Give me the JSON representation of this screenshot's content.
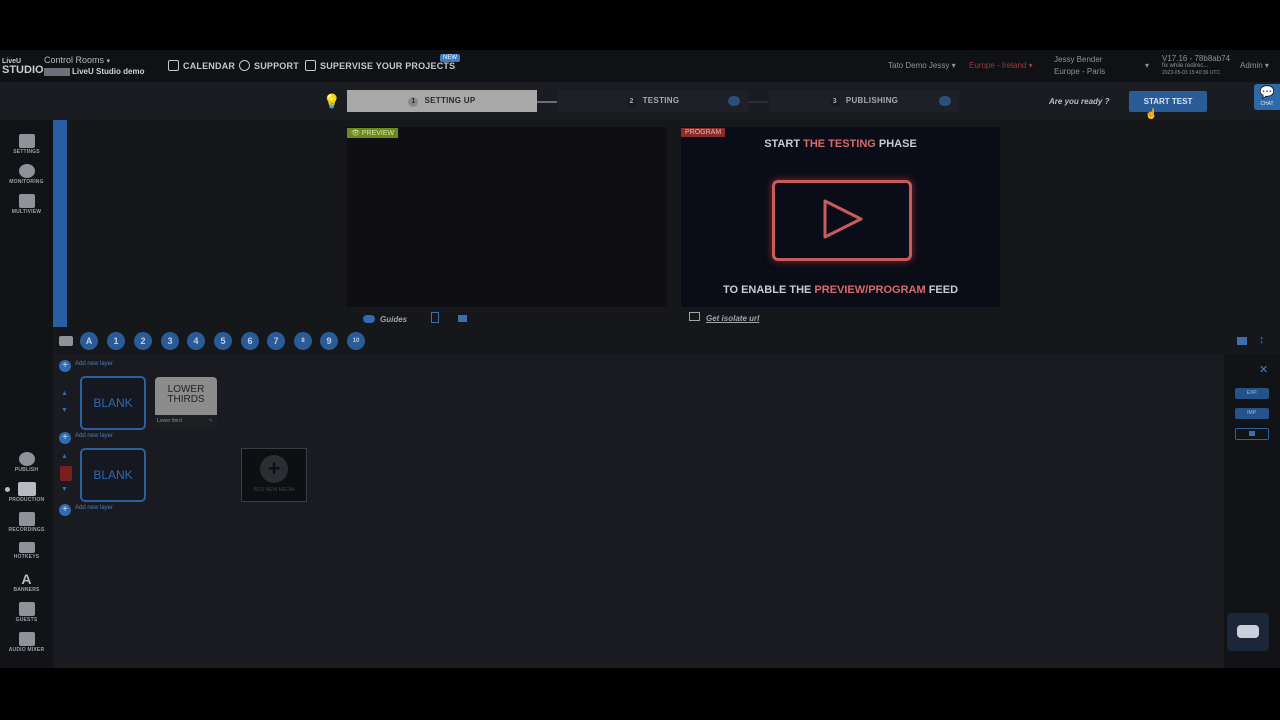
{
  "topbar": {
    "logo_line1": "LiveU",
    "logo_line2": "STUDIO",
    "control_rooms_label": "Control Rooms",
    "studio_name": "LiveU Studio demo",
    "nav": {
      "calendar": "CALENDAR",
      "support": "SUPPORT",
      "supervise": "SUPERVISE YOUR PROJECTS",
      "new_badge": "NEW"
    },
    "account": "Tato Demo Jessy",
    "region": "Europe - Ireland",
    "user_name": "Jessy Bender",
    "user_region": "Europe - Paris",
    "version": "V17.16 - 78b8ab74",
    "version_note": "fix while redirec...",
    "version_date": "2023-05-03 15:40:36 UTC",
    "admin": "Admin"
  },
  "wizard": {
    "steps": [
      {
        "num": "1",
        "label": "SETTING UP"
      },
      {
        "num": "2",
        "label": "TESTING"
      },
      {
        "num": "3",
        "label": "PUBLISHING"
      }
    ],
    "ready_text": "Are you ready ?",
    "start_button": "START TEST",
    "chat_label": "CHAT"
  },
  "sidebar": {
    "items": [
      {
        "label": "SETTINGS"
      },
      {
        "label": "MONITORING"
      },
      {
        "label": "MULTIVIEW"
      },
      {
        "label": "PUBLISH"
      },
      {
        "label": "PRODUCTION"
      },
      {
        "label": "RECORDINGS"
      },
      {
        "label": "HOTKEYS"
      },
      {
        "label": "BANNERS"
      },
      {
        "label": "GUESTS"
      },
      {
        "label": "AUDIO MIXER"
      }
    ]
  },
  "monitors": {
    "preview_label": "PREVIEW",
    "program_label": "PROGRAM",
    "program_title_a": "START ",
    "program_title_b": "THE TESTING",
    "program_title_c": " PHASE",
    "program_foot_a": "TO ENABLE THE ",
    "program_foot_b": "PREVIEW/PROGRAM",
    "program_foot_c": " FEED",
    "guides_label": "Guides",
    "get_url_label": "Get isolate url"
  },
  "layers": {
    "keys": [
      "A",
      "1",
      "2",
      "3",
      "4",
      "5",
      "6",
      "7",
      "8",
      "9",
      "10"
    ],
    "add_layer": "Add new layer",
    "blank_label": "BLANK",
    "lower_thirds_line1": "LOWER",
    "lower_thirds_line2": "THIRDS",
    "lower_thirds_footer": "Lower third",
    "add_media": "ADD NEW MEDIA"
  },
  "right_panel": {
    "btn1": "EXP.",
    "btn2": "IMP."
  }
}
